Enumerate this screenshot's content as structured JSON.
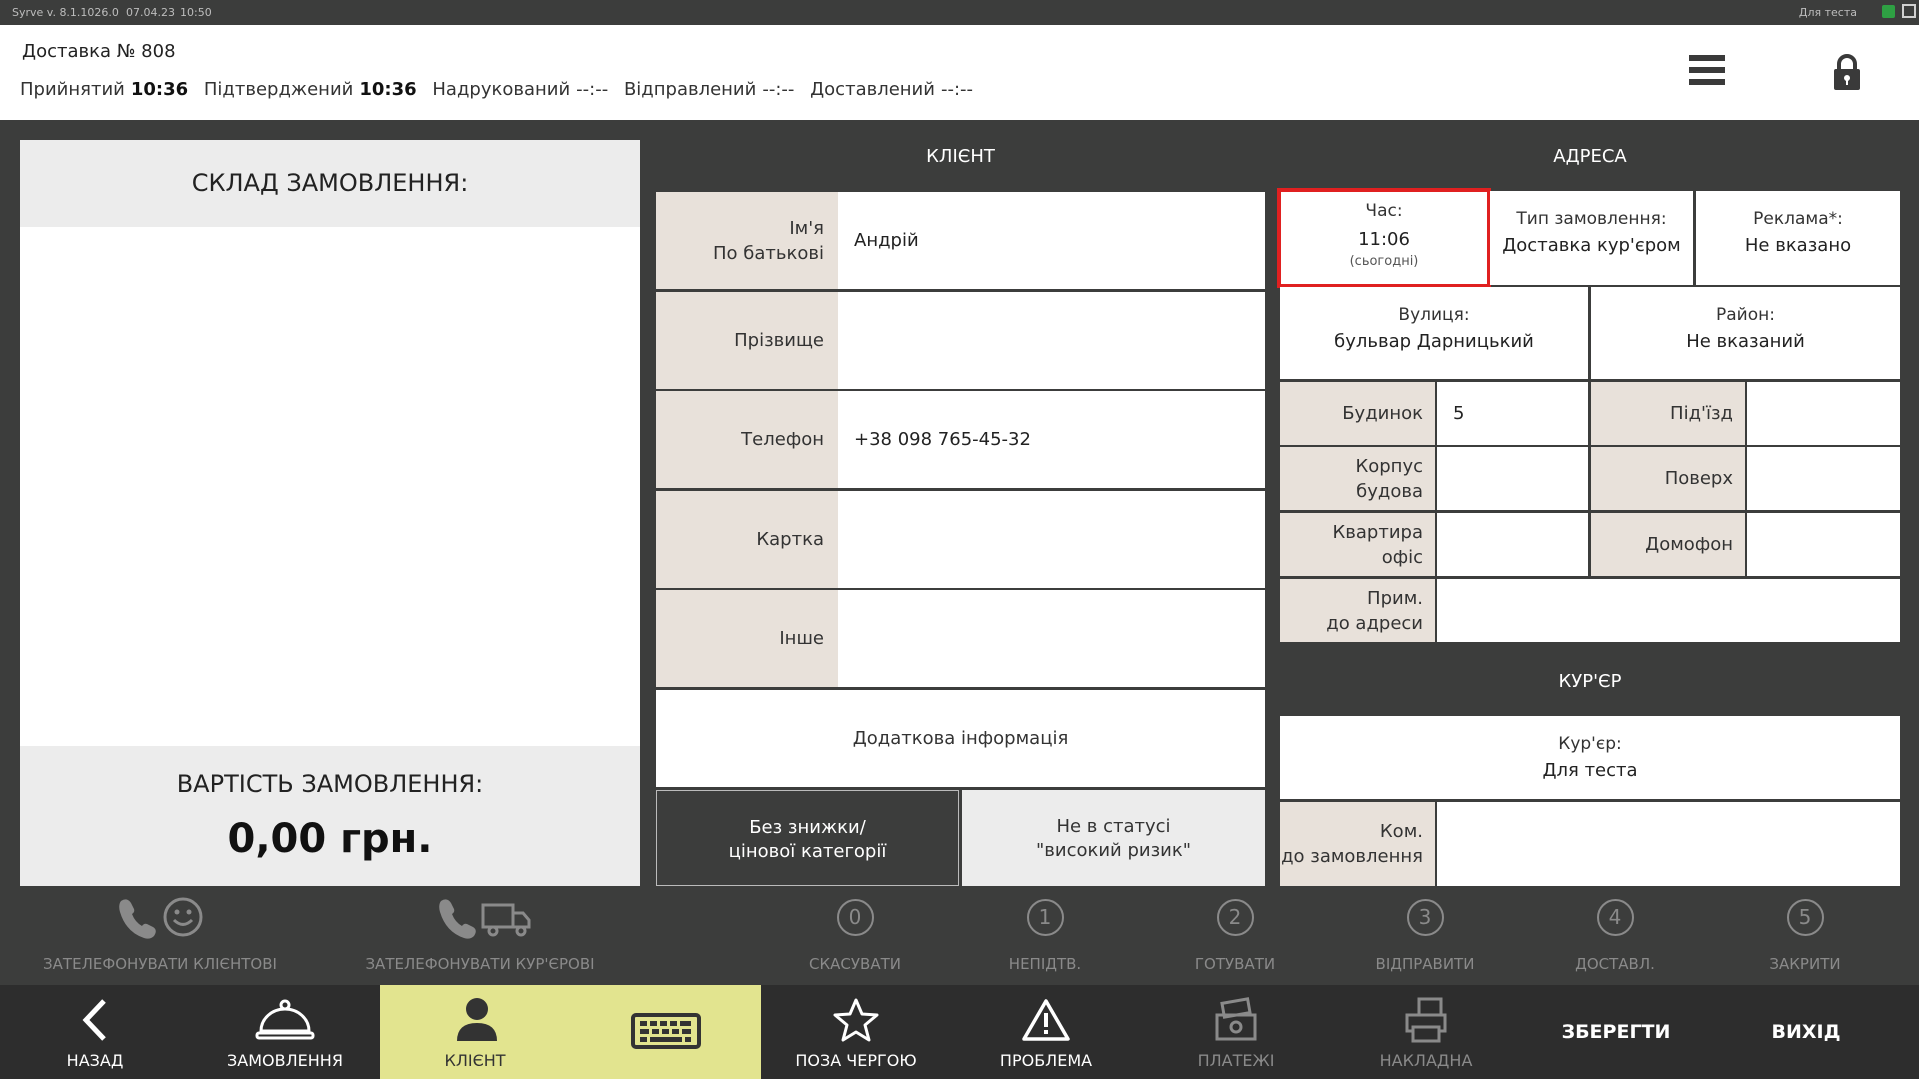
{
  "statusbar": {
    "version": "Syrve v. 8.1.1026.0",
    "date": "07.04.23",
    "time": "10:50",
    "user": "Для теста"
  },
  "header": {
    "title": "Доставка № 808",
    "accepted_label": "Прийнятий",
    "accepted_time": "10:36",
    "confirmed_label": "Підтверджений",
    "confirmed_time": "10:36",
    "printed_label": "Надрукований",
    "printed_time": "--:--",
    "sent_label": "Відправлений",
    "sent_time": "--:--",
    "delivered_label": "Доставлений",
    "delivered_time": "--:--",
    "menu_icon": "hamburger-icon",
    "lock_icon": "lock-icon"
  },
  "order": {
    "composition_title": "СКЛАД ЗАМОВЛЕННЯ:",
    "cost_title": "ВАРТІСТЬ ЗАМОВЛЕННЯ:",
    "cost_value": "0,00 грн."
  },
  "client": {
    "title": "КЛІЄНТ",
    "name_label_1": "Ім'я",
    "name_label_2": "По батькові",
    "name_value": "Андрій",
    "surname_label": "Прізвище",
    "surname_value": "",
    "phone_label": "Телефон",
    "phone_value": "+38 098 765-45-32",
    "card_label": "Картка",
    "card_value": "",
    "other_label": "Інше",
    "other_value": "",
    "extra_info": "Додаткова інформація",
    "discount_1": "Без знижки/",
    "discount_2": "цінової категорії",
    "risk_1": "Не в статусі",
    "risk_2": "\"високий ризик\""
  },
  "address": {
    "title": "АДРЕСА",
    "time_label": "Час:",
    "time_value": "11:06",
    "time_note": "(сьогодні)",
    "type_label": "Тип замовлення:",
    "type_value": "Доставка кур'єром",
    "ad_label": "Реклама*:",
    "ad_value": "Не вказано",
    "street_label": "Вулиця:",
    "street_value": "бульвар Дарницький",
    "district_label": "Район:",
    "district_value": "Не вказаний",
    "house_label": "Будинок",
    "house_value": "5",
    "entrance_label": "Під'їзд",
    "entrance_value": "",
    "building_label_1": "Корпус",
    "building_label_2": "будова",
    "building_value": "",
    "floor_label": "Поверх",
    "floor_value": "",
    "flat_label_1": "Квартира",
    "flat_label_2": "офіс",
    "flat_value": "",
    "intercom_label": "Домофон",
    "intercom_value": "",
    "note_label_1": "Прим.",
    "note_label_2": "до адреси",
    "note_value": ""
  },
  "courier": {
    "title": "КУР'ЄР",
    "courier_label": "Кур'єр:",
    "courier_value": "Для теста",
    "comment_label_1": "Ком.",
    "comment_label_2": "до замовлення",
    "comment_value": ""
  },
  "actions": {
    "call_client": "ЗАТЕЛЕФОНУВАТИ КЛІЄНТОВІ",
    "call_courier": "ЗАТЕЛЕФОНУВАТИ КУР'ЄРОВІ",
    "steps": [
      {
        "num": "0",
        "label": "СКАСУВАТИ"
      },
      {
        "num": "1",
        "label": "НЕПІДТВ."
      },
      {
        "num": "2",
        "label": "ГОТУВАТИ"
      },
      {
        "num": "3",
        "label": "ВІДПРАВИТИ"
      },
      {
        "num": "4",
        "label": "ДОСТАВЛ."
      },
      {
        "num": "5",
        "label": "ЗАКРИТИ"
      }
    ]
  },
  "nav": {
    "back": "НАЗАД",
    "orders": "ЗАМОВЛЕННЯ",
    "client": "КЛІЄНТ",
    "out_of_turn": "ПОЗА ЧЕРГОЮ",
    "problem": "ПРОБЛЕМА",
    "payments": "ПЛАТЕЖІ",
    "invoice": "НАКЛАДНА",
    "save": "ЗБЕРЕГТИ",
    "exit": "ВИХІД"
  },
  "colors": {
    "background": "#3c3d3c",
    "label_bg": "#e8e1da",
    "active_nav": "#e2e48f",
    "highlight": "#e02020"
  }
}
